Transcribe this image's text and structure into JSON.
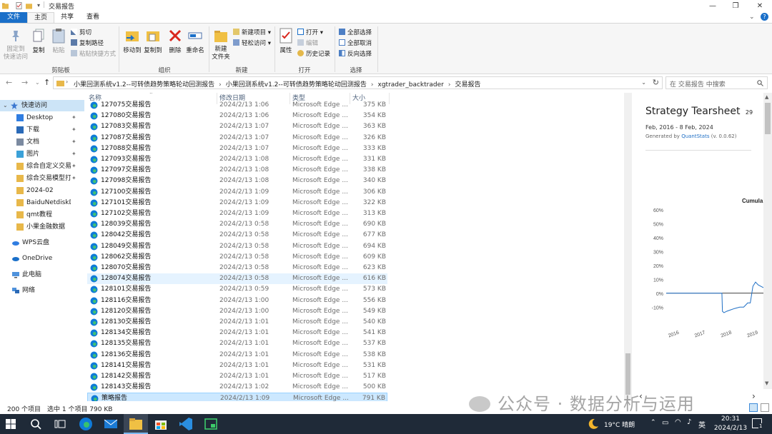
{
  "window": {
    "title": "交易报告"
  },
  "ribbon": {
    "tabs": [
      "文件",
      "主页",
      "共享",
      "查看"
    ],
    "clipboard": {
      "pin": "固定到\n快速访问",
      "copy": "复制",
      "paste": "粘贴",
      "cut": "剪切",
      "copy_path": "复制路径",
      "paste_shortcut": "粘贴快捷方式",
      "group": "剪贴板"
    },
    "organize": {
      "move_to": "移动到",
      "copy_to": "复制到",
      "delete": "删除",
      "rename": "重命名",
      "group": "组织"
    },
    "new": {
      "new_folder": "新建\n文件夹",
      "new_item": "新建项目",
      "easy_access": "轻松访问",
      "group": "新建"
    },
    "open": {
      "properties": "属性",
      "open": "打开",
      "edit": "编辑",
      "history": "历史记录",
      "group": "打开"
    },
    "select": {
      "select_all": "全部选择",
      "select_none": "全部取消",
      "invert": "反向选择",
      "group": "选择"
    }
  },
  "address": {
    "crumbs": [
      "小果回测系统v1.2--可转债趋势策略轮动回测报告",
      "小果回测系统v1.2--可转债趋势策略轮动回测报告",
      "xgtrader_backtrader",
      "交易报告"
    ],
    "search_placeholder": "在 交易报告 中搜索"
  },
  "nav": {
    "quick_access": "快速访问",
    "items": [
      {
        "label": "Desktop",
        "pinned": true
      },
      {
        "label": "下载",
        "pinned": true
      },
      {
        "label": "文档",
        "pinned": true
      },
      {
        "label": "图片",
        "pinned": true
      },
      {
        "label": "综合自定义交易",
        "pinned": true
      },
      {
        "label": "综合交易模型打包",
        "pinned": true
      },
      {
        "label": "2024-02",
        "pinned": false
      },
      {
        "label": "BaiduNetdiskDow",
        "pinned": false
      },
      {
        "label": "qmt教程",
        "pinned": false
      },
      {
        "label": "小果金融数据",
        "pinned": false
      }
    ],
    "wps": "WPS云盘",
    "onedrive": "OneDrive",
    "this_pc": "此电脑",
    "network": "网络"
  },
  "columns": {
    "name": "名称",
    "modified": "修改日期",
    "type": "类型",
    "size": "大小"
  },
  "files": [
    {
      "name": "127075交易报告",
      "date": "2024/2/13 1:06",
      "type": "Microsoft Edge ...",
      "size": "375 KB"
    },
    {
      "name": "127080交易报告",
      "date": "2024/2/13 1:06",
      "type": "Microsoft Edge ...",
      "size": "354 KB"
    },
    {
      "name": "127083交易报告",
      "date": "2024/2/13 1:07",
      "type": "Microsoft Edge ...",
      "size": "363 KB"
    },
    {
      "name": "127087交易报告",
      "date": "2024/2/13 1:07",
      "type": "Microsoft Edge ...",
      "size": "326 KB"
    },
    {
      "name": "127088交易报告",
      "date": "2024/2/13 1:07",
      "type": "Microsoft Edge ...",
      "size": "333 KB"
    },
    {
      "name": "127093交易报告",
      "date": "2024/2/13 1:08",
      "type": "Microsoft Edge ...",
      "size": "331 KB"
    },
    {
      "name": "127097交易报告",
      "date": "2024/2/13 1:08",
      "type": "Microsoft Edge ...",
      "size": "338 KB"
    },
    {
      "name": "127098交易报告",
      "date": "2024/2/13 1:08",
      "type": "Microsoft Edge ...",
      "size": "340 KB"
    },
    {
      "name": "127100交易报告",
      "date": "2024/2/13 1:09",
      "type": "Microsoft Edge ...",
      "size": "306 KB"
    },
    {
      "name": "127101交易报告",
      "date": "2024/2/13 1:09",
      "type": "Microsoft Edge ...",
      "size": "322 KB"
    },
    {
      "name": "127102交易报告",
      "date": "2024/2/13 1:09",
      "type": "Microsoft Edge ...",
      "size": "313 KB"
    },
    {
      "name": "128039交易报告",
      "date": "2024/2/13 0:58",
      "type": "Microsoft Edge ...",
      "size": "690 KB"
    },
    {
      "name": "128042交易报告",
      "date": "2024/2/13 0:58",
      "type": "Microsoft Edge ...",
      "size": "677 KB"
    },
    {
      "name": "128049交易报告",
      "date": "2024/2/13 0:58",
      "type": "Microsoft Edge ...",
      "size": "694 KB"
    },
    {
      "name": "128062交易报告",
      "date": "2024/2/13 0:58",
      "type": "Microsoft Edge ...",
      "size": "609 KB"
    },
    {
      "name": "128070交易报告",
      "date": "2024/2/13 0:58",
      "type": "Microsoft Edge ...",
      "size": "623 KB"
    },
    {
      "name": "128074交易报告",
      "date": "2024/2/13 0:58",
      "type": "Microsoft Edge ...",
      "size": "616 KB"
    },
    {
      "name": "128101交易报告",
      "date": "2024/2/13 0:59",
      "type": "Microsoft Edge ...",
      "size": "573 KB"
    },
    {
      "name": "128116交易报告",
      "date": "2024/2/13 1:00",
      "type": "Microsoft Edge ...",
      "size": "556 KB"
    },
    {
      "name": "128120交易报告",
      "date": "2024/2/13 1:00",
      "type": "Microsoft Edge ...",
      "size": "549 KB"
    },
    {
      "name": "128130交易报告",
      "date": "2024/2/13 1:01",
      "type": "Microsoft Edge ...",
      "size": "540 KB"
    },
    {
      "name": "128134交易报告",
      "date": "2024/2/13 1:01",
      "type": "Microsoft Edge ...",
      "size": "541 KB"
    },
    {
      "name": "128135交易报告",
      "date": "2024/2/13 1:01",
      "type": "Microsoft Edge ...",
      "size": "537 KB"
    },
    {
      "name": "128136交易报告",
      "date": "2024/2/13 1:01",
      "type": "Microsoft Edge ...",
      "size": "538 KB"
    },
    {
      "name": "128141交易报告",
      "date": "2024/2/13 1:01",
      "type": "Microsoft Edge ...",
      "size": "531 KB"
    },
    {
      "name": "128142交易报告",
      "date": "2024/2/13 1:01",
      "type": "Microsoft Edge ...",
      "size": "517 KB"
    },
    {
      "name": "128143交易报告",
      "date": "2024/2/13 1:02",
      "type": "Microsoft Edge ...",
      "size": "500 KB"
    },
    {
      "name": "策略报告",
      "date": "2024/2/13 1:09",
      "type": "Microsoft Edge ...",
      "size": "791 KB"
    }
  ],
  "hover_index": 16,
  "selected_index": 27,
  "preview": {
    "title": "Strategy Tearsheet",
    "title_suffix": "29",
    "daterange": "Feb, 2016 - 8 Feb, 2024",
    "generated_prefix": "Generated by ",
    "generated_link": "QuantStats",
    "generated_suffix": " (v. 0.0.62)",
    "chart_title": "Cumula",
    "accent": "#1f6fc5"
  },
  "chart_data": {
    "type": "line",
    "title": "Cumula",
    "yticks": [
      "60%",
      "50%",
      "40%",
      "30%",
      "20%",
      "10%",
      "0%",
      "-10%"
    ],
    "xticks": [
      "2016",
      "2017",
      "2018",
      "2019"
    ],
    "ylim": [
      -15,
      62
    ],
    "xlim": [
      2015.9,
      2019.6
    ],
    "series": [
      {
        "x": [
          2015.9,
          2018.02,
          2018.04,
          2018.1,
          2018.2,
          2018.35,
          2018.5,
          2018.7,
          2018.85,
          2019.0,
          2019.1,
          2019.2,
          2019.3,
          2019.4,
          2019.5,
          2019.6
        ],
        "y": [
          0,
          0,
          -13,
          -14,
          -13,
          -12,
          -11,
          -10,
          -10,
          -7,
          -7,
          5,
          8,
          6,
          5,
          4
        ]
      }
    ],
    "grid": false
  },
  "status": {
    "count": "200 个项目",
    "selected": "选中 1 个项目  790 KB"
  },
  "taskbar": {
    "weather": "19°C  晴朗",
    "ime": "英",
    "time": "20:31",
    "date": "2024/2/13",
    "notif": "1"
  },
  "watermark": "公众号 · 数据分析与运用"
}
